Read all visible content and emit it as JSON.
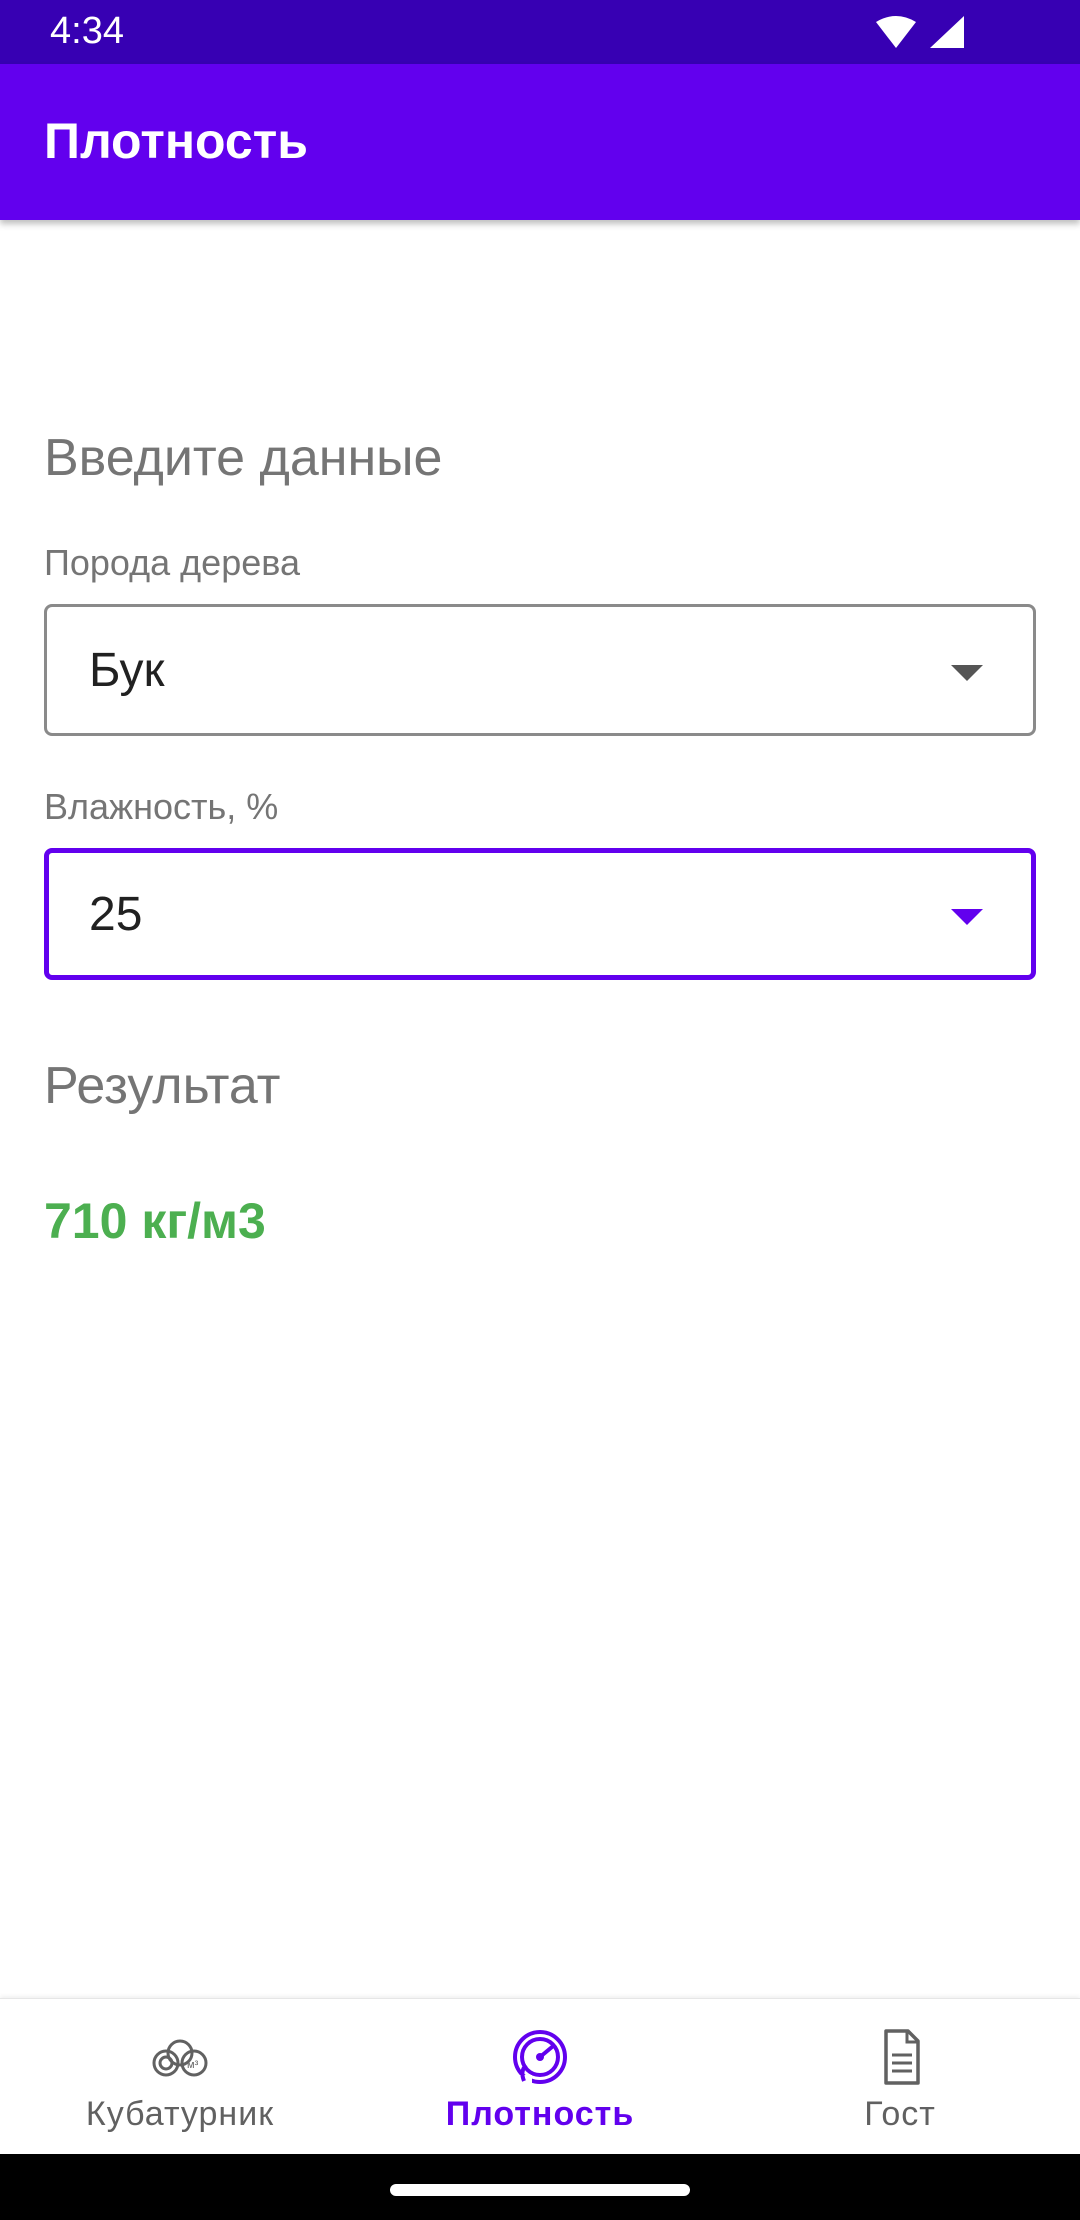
{
  "status_bar": {
    "time": "4:34"
  },
  "app_bar": {
    "title": "Плотность"
  },
  "form": {
    "heading": "Введите данные",
    "species_label": "Порода дерева",
    "species_value": "Бук",
    "humidity_label": "Влажность, %",
    "humidity_value": "25"
  },
  "result": {
    "heading": "Результат",
    "value": "710 кг/м3"
  },
  "bottom_nav": {
    "items": [
      {
        "label": "Кубатурник",
        "icon": "logs-m3-icon",
        "active": false
      },
      {
        "label": "Плотность",
        "icon": "gauge-icon",
        "active": true
      },
      {
        "label": "Гост",
        "icon": "document-icon",
        "active": false
      }
    ]
  },
  "colors": {
    "primary": "#6200ee",
    "primary_dark": "#3700b3",
    "result_green": "#4caf50",
    "muted_text": "#757575"
  }
}
